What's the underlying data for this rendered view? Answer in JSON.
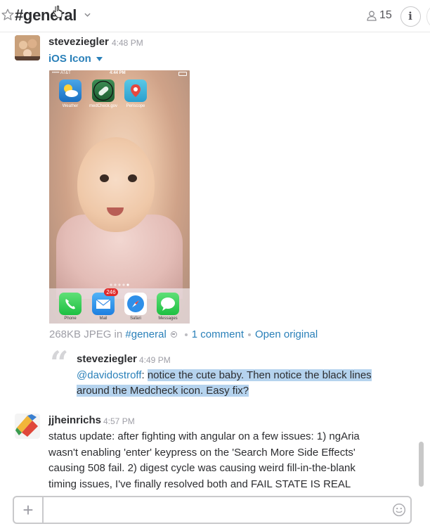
{
  "header": {
    "channel_name": "#general",
    "member_count": "15",
    "info_label": "i"
  },
  "messages": [
    {
      "author": "steveziegler",
      "time": "4:48 PM",
      "file": {
        "title": "iOS  Icon",
        "screenshot": {
          "carrier": "••••• AT&T",
          "clock": "4:44 PM",
          "top_icons": [
            "Weather",
            "medCheck.gov",
            "Periscope"
          ],
          "dock_icons": [
            "Phone",
            "Mail",
            "Safari",
            "Messages"
          ],
          "mail_badge": "246"
        },
        "meta_size": "268KB JPEG in",
        "meta_channel": "#general",
        "comment_link": "1 comment",
        "open_link": "Open original"
      },
      "comment": {
        "author": "steveziegler",
        "time": "4:49 PM",
        "mention": "@davidostroff",
        "separator": ":",
        "text": "notice the cute baby. Then notice the black lines around the Medcheck icon. Easy fix?"
      }
    },
    {
      "author": "jjheinrichs",
      "time": "4:57 PM",
      "text": "status update: after fighting with angular on a few issues: 1) ngAria wasn't enabling 'enter' keypress on the 'Search More Side Effects' causing 508 fail. 2) digest cycle was causing weird fill-in-the-blank timing issues, I've finally resolved both and FAIL STATE IS REAL CLOSE."
    }
  ],
  "composer": {
    "plus_label": "+",
    "input_value": ""
  },
  "colors": {
    "link": "#2a80b9",
    "highlight": "#b5d3ee",
    "muted": "#9e9ea6"
  }
}
